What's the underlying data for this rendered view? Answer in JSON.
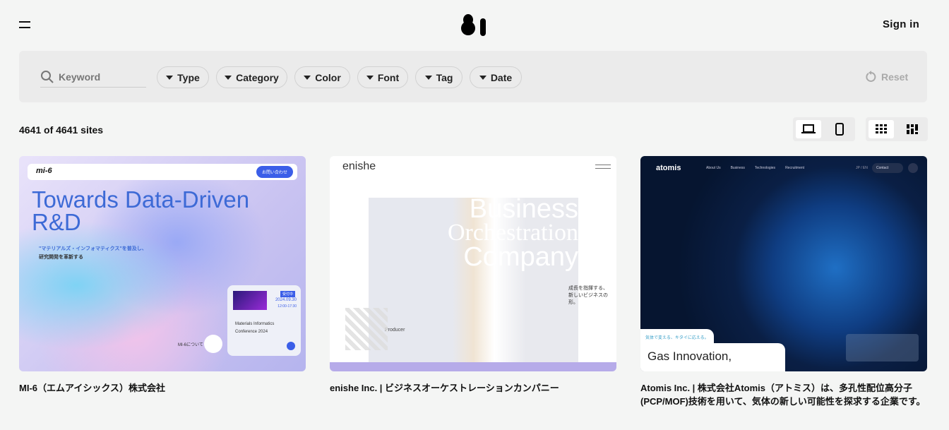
{
  "header": {
    "menu_icon": "hamburger-icon",
    "logo_alt": "81",
    "signin": "Sign in"
  },
  "filters": {
    "search_placeholder": "Keyword",
    "pills": [
      "Type",
      "Category",
      "Color",
      "Font",
      "Tag",
      "Date"
    ],
    "reset": "Reset"
  },
  "results": {
    "count": "4641 of 4641 sites"
  },
  "view_toggles": {
    "device": [
      "desktop",
      "mobile"
    ],
    "device_selected": "desktop",
    "layout": [
      "grid",
      "masonry"
    ],
    "layout_selected": "grid"
  },
  "cards": [
    {
      "caption": "MI-6（エムアイシックス）株式会社",
      "thumb": {
        "logo": "mi-6",
        "cta": "お問い合わせ",
        "headline1": "Towards Data-Driven",
        "headline2": "R&D",
        "sub1": "\"マテリアルズ・インフォマティクス\"を普及し、",
        "sub2": "研究開発を革新する",
        "badge": "受付中",
        "date": "2024.09.30",
        "time": "12:00-17:30",
        "event1": "Materials Informatics",
        "event2": "Conference 2024",
        "about": "MI-6について"
      }
    },
    {
      "caption": "enishe Inc. | ビジネスオーケストレーションカンパニー",
      "thumb": {
        "logo": "enishe",
        "w1": "Business",
        "w2": "Orchestration",
        "w3": "Company",
        "jp1": "成長を指揮する、",
        "jp2": "新しいビジネスの形。",
        "producer": "Producer"
      }
    },
    {
      "caption": "Atomis Inc. | 株式会社Atomis（アトミス）は、多孔性配位高分子(PCP/MOF)技術を用いて、気体の新しい可能性を探求する企業です。",
      "thumb": {
        "logo": "atomis",
        "nav": [
          "About Us",
          "Business",
          "Technologies",
          "Recruitment"
        ],
        "lang": "JP / EN",
        "contact": "Contact",
        "tag": "気体で変える、キタイに応える。",
        "headline": "Gas Innovation,"
      }
    }
  ]
}
